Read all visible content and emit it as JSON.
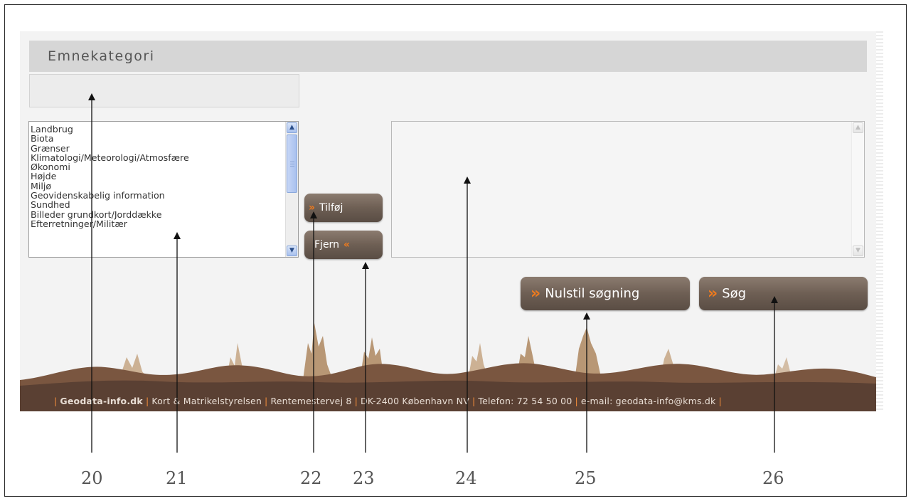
{
  "section": {
    "title": "Emnekategori"
  },
  "categories": {
    "items": [
      "Landbrug",
      "Biota",
      "Grænser",
      "Klimatologi/Meteorologi/Atmosfære",
      "Økonomi",
      "Højde",
      "Miljø",
      "Geovidenskabelig information",
      "Sundhed",
      "Billeder grundkort/Jorddække",
      "Efterretninger/Militær"
    ]
  },
  "buttons": {
    "add_label": "Tilføj",
    "remove_label": "Fjern",
    "reset_label": "Nulstil søgning",
    "search_label": "Søg",
    "chevron_right": "»",
    "chevron_left": "«"
  },
  "footer": {
    "site": "Geodata-info.dk",
    "org": "Kort & Matrikelstyrelsen",
    "street": "Rentemestervej 8",
    "city": "DK-2400 København NV",
    "phone": "Telefon: 72 54 50 00",
    "email": "e-mail: geodata-info@kms.dk"
  },
  "callouts": [
    "20",
    "21",
    "22",
    "23",
    "24",
    "25",
    "26"
  ],
  "colors": {
    "button_gradient_top": "#8b7b6f",
    "button_gradient_bottom": "#5a4d44",
    "accent_chevron": "#f07b1d",
    "footer_bg": "#5a4033",
    "header_bg": "#d6d6d6"
  },
  "icons": {
    "scroll_up": "scroll-up-arrow-icon",
    "scroll_down": "scroll-down-arrow-icon",
    "chevron": "double-chevron-icon"
  }
}
